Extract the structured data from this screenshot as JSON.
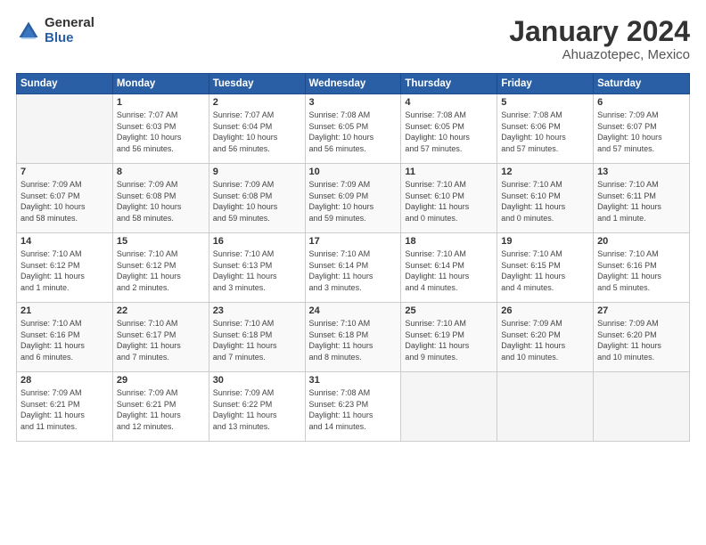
{
  "logo": {
    "general": "General",
    "blue": "Blue"
  },
  "header": {
    "title": "January 2024",
    "subtitle": "Ahuazotepec, Mexico"
  },
  "days_of_week": [
    "Sunday",
    "Monday",
    "Tuesday",
    "Wednesday",
    "Thursday",
    "Friday",
    "Saturday"
  ],
  "weeks": [
    [
      {
        "day": "",
        "info": ""
      },
      {
        "day": "1",
        "info": "Sunrise: 7:07 AM\nSunset: 6:03 PM\nDaylight: 10 hours\nand 56 minutes."
      },
      {
        "day": "2",
        "info": "Sunrise: 7:07 AM\nSunset: 6:04 PM\nDaylight: 10 hours\nand 56 minutes."
      },
      {
        "day": "3",
        "info": "Sunrise: 7:08 AM\nSunset: 6:05 PM\nDaylight: 10 hours\nand 56 minutes."
      },
      {
        "day": "4",
        "info": "Sunrise: 7:08 AM\nSunset: 6:05 PM\nDaylight: 10 hours\nand 57 minutes."
      },
      {
        "day": "5",
        "info": "Sunrise: 7:08 AM\nSunset: 6:06 PM\nDaylight: 10 hours\nand 57 minutes."
      },
      {
        "day": "6",
        "info": "Sunrise: 7:09 AM\nSunset: 6:07 PM\nDaylight: 10 hours\nand 57 minutes."
      }
    ],
    [
      {
        "day": "7",
        "info": "Sunrise: 7:09 AM\nSunset: 6:07 PM\nDaylight: 10 hours\nand 58 minutes."
      },
      {
        "day": "8",
        "info": "Sunrise: 7:09 AM\nSunset: 6:08 PM\nDaylight: 10 hours\nand 58 minutes."
      },
      {
        "day": "9",
        "info": "Sunrise: 7:09 AM\nSunset: 6:08 PM\nDaylight: 10 hours\nand 59 minutes."
      },
      {
        "day": "10",
        "info": "Sunrise: 7:09 AM\nSunset: 6:09 PM\nDaylight: 10 hours\nand 59 minutes."
      },
      {
        "day": "11",
        "info": "Sunrise: 7:10 AM\nSunset: 6:10 PM\nDaylight: 11 hours\nand 0 minutes."
      },
      {
        "day": "12",
        "info": "Sunrise: 7:10 AM\nSunset: 6:10 PM\nDaylight: 11 hours\nand 0 minutes."
      },
      {
        "day": "13",
        "info": "Sunrise: 7:10 AM\nSunset: 6:11 PM\nDaylight: 11 hours\nand 1 minute."
      }
    ],
    [
      {
        "day": "14",
        "info": "Sunrise: 7:10 AM\nSunset: 6:12 PM\nDaylight: 11 hours\nand 1 minute."
      },
      {
        "day": "15",
        "info": "Sunrise: 7:10 AM\nSunset: 6:12 PM\nDaylight: 11 hours\nand 2 minutes."
      },
      {
        "day": "16",
        "info": "Sunrise: 7:10 AM\nSunset: 6:13 PM\nDaylight: 11 hours\nand 3 minutes."
      },
      {
        "day": "17",
        "info": "Sunrise: 7:10 AM\nSunset: 6:14 PM\nDaylight: 11 hours\nand 3 minutes."
      },
      {
        "day": "18",
        "info": "Sunrise: 7:10 AM\nSunset: 6:14 PM\nDaylight: 11 hours\nand 4 minutes."
      },
      {
        "day": "19",
        "info": "Sunrise: 7:10 AM\nSunset: 6:15 PM\nDaylight: 11 hours\nand 4 minutes."
      },
      {
        "day": "20",
        "info": "Sunrise: 7:10 AM\nSunset: 6:16 PM\nDaylight: 11 hours\nand 5 minutes."
      }
    ],
    [
      {
        "day": "21",
        "info": "Sunrise: 7:10 AM\nSunset: 6:16 PM\nDaylight: 11 hours\nand 6 minutes."
      },
      {
        "day": "22",
        "info": "Sunrise: 7:10 AM\nSunset: 6:17 PM\nDaylight: 11 hours\nand 7 minutes."
      },
      {
        "day": "23",
        "info": "Sunrise: 7:10 AM\nSunset: 6:18 PM\nDaylight: 11 hours\nand 7 minutes."
      },
      {
        "day": "24",
        "info": "Sunrise: 7:10 AM\nSunset: 6:18 PM\nDaylight: 11 hours\nand 8 minutes."
      },
      {
        "day": "25",
        "info": "Sunrise: 7:10 AM\nSunset: 6:19 PM\nDaylight: 11 hours\nand 9 minutes."
      },
      {
        "day": "26",
        "info": "Sunrise: 7:09 AM\nSunset: 6:20 PM\nDaylight: 11 hours\nand 10 minutes."
      },
      {
        "day": "27",
        "info": "Sunrise: 7:09 AM\nSunset: 6:20 PM\nDaylight: 11 hours\nand 10 minutes."
      }
    ],
    [
      {
        "day": "28",
        "info": "Sunrise: 7:09 AM\nSunset: 6:21 PM\nDaylight: 11 hours\nand 11 minutes."
      },
      {
        "day": "29",
        "info": "Sunrise: 7:09 AM\nSunset: 6:21 PM\nDaylight: 11 hours\nand 12 minutes."
      },
      {
        "day": "30",
        "info": "Sunrise: 7:09 AM\nSunset: 6:22 PM\nDaylight: 11 hours\nand 13 minutes."
      },
      {
        "day": "31",
        "info": "Sunrise: 7:08 AM\nSunset: 6:23 PM\nDaylight: 11 hours\nand 14 minutes."
      },
      {
        "day": "",
        "info": ""
      },
      {
        "day": "",
        "info": ""
      },
      {
        "day": "",
        "info": ""
      }
    ]
  ]
}
